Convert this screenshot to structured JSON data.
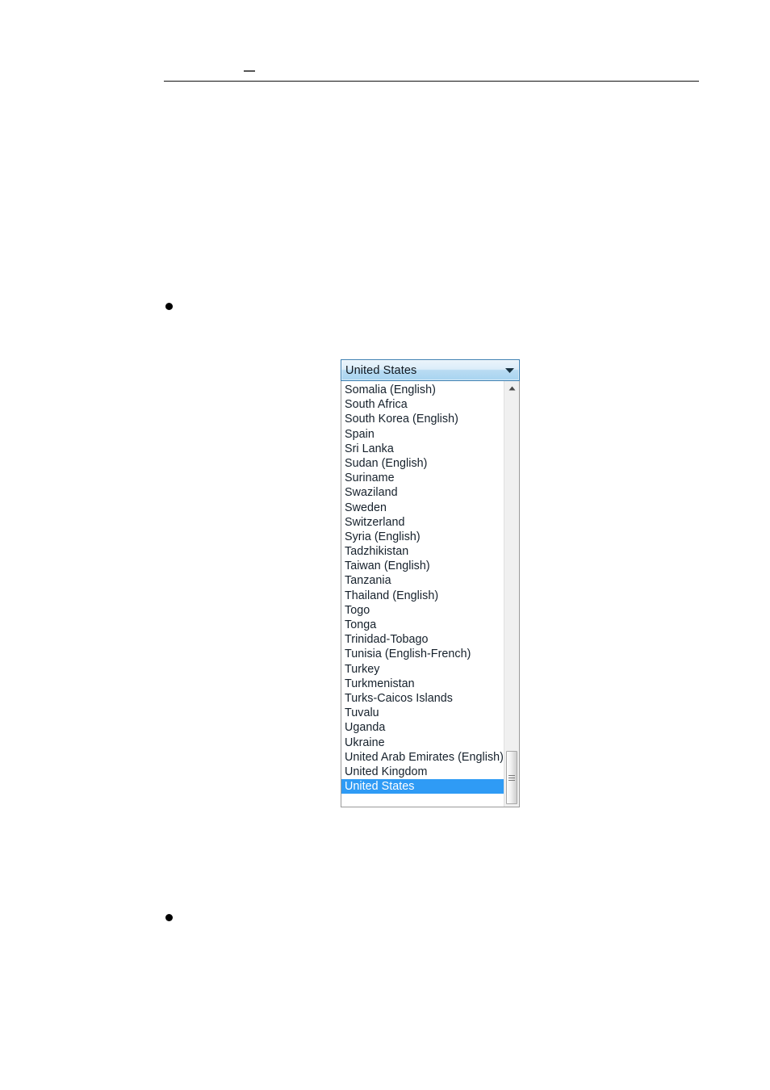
{
  "document": {
    "header_dash": "—",
    "bullets": [
      "bullet",
      "bullet"
    ]
  },
  "combo": {
    "name": "country-select",
    "selected_value": "United States",
    "arrow_icon": "chevron-down-icon",
    "border_color": "#3c7fb1",
    "highlight_color": "#2f9bf5",
    "items": [
      "Somalia (English)",
      "South Africa",
      "South Korea (English)",
      "Spain",
      "Sri Lanka",
      "Sudan (English)",
      "Suriname",
      "Swaziland",
      "Sweden",
      "Switzerland",
      "Syria (English)",
      "Tadzhikistan",
      "Taiwan (English)",
      "Tanzania",
      "Thailand (English)",
      "Togo",
      "Tonga",
      "Trinidad-Tobago",
      "Tunisia (English-French)",
      "Turkey",
      "Turkmenistan",
      "Turks-Caicos Islands",
      "Tuvalu",
      "Uganda",
      "Ukraine",
      "United Arab Emirates (English)",
      "United Kingdom",
      "United States"
    ],
    "selected_index": 27,
    "scrollbar": {
      "up_arrow_icon": "scroll-up-arrow-icon",
      "thumb_icon": "scrollbar-thumb-grip-icon"
    }
  }
}
